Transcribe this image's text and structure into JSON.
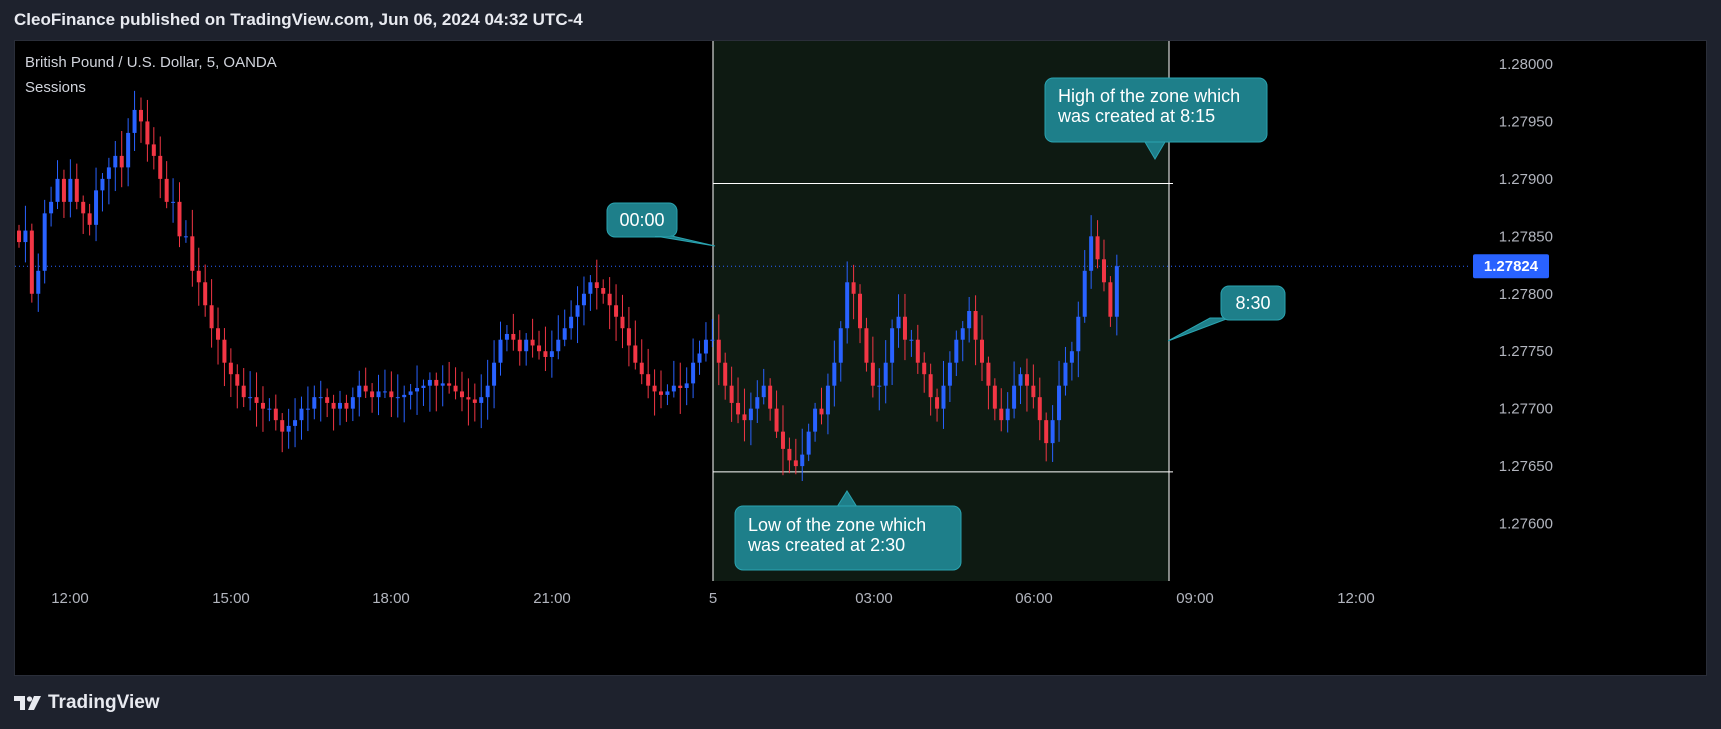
{
  "header": {
    "published": "CleoFinance published on TradingView.com, Jun 06, 2024 04:32 UTC-4"
  },
  "footer": {
    "brand": "TradingView",
    "logo_icon": "tradingview-logo-icon"
  },
  "colors": {
    "up": "#2962ff",
    "down": "#f23645",
    "zone_fill": "#0e1a12",
    "callout": "#1e7f8a",
    "price_tag": "#2962ff",
    "axis_text": "#b2b5be"
  },
  "chart_data": {
    "type": "candlestick",
    "symbol_line": "British Pound / U.S. Dollar, 5, OANDA",
    "indicator": "Sessions",
    "y_ticks": [
      "1.28000",
      "1.27950",
      "1.27900",
      "1.27850",
      "1.27800",
      "1.27750",
      "1.27700",
      "1.27650",
      "1.27600"
    ],
    "ylim": [
      1.2755,
      1.2802
    ],
    "x_ticks": [
      "12:00",
      "15:00",
      "18:00",
      "21:00",
      "5",
      "03:00",
      "06:00",
      "09:00",
      "12:00"
    ],
    "last_price": "1.27824",
    "session_zone": {
      "start": "00:00",
      "end": "08:30",
      "high": 1.27896,
      "low": 1.27645
    },
    "annotations": {
      "start_label": "00:00",
      "end_label": "8:30",
      "high_note": [
        "High of the zone which",
        "was created at 8:15"
      ],
      "low_note": [
        "Low of the zone which",
        "was created at 2:30"
      ]
    },
    "series": [
      {
        "name": "close",
        "values": [
          1.27845,
          1.27855,
          1.278,
          1.2782,
          1.2787,
          1.2788,
          1.279,
          1.2788,
          1.279,
          1.2788,
          1.2787,
          1.2786,
          1.2789,
          1.279,
          1.2791,
          1.2792,
          1.2791,
          1.2794,
          1.2796,
          1.2795,
          1.2793,
          1.2792,
          1.279,
          1.2788,
          1.2788,
          1.2785,
          1.2785,
          1.2782,
          1.2781,
          1.2779,
          1.2777,
          1.2776,
          1.2774,
          1.2773,
          1.2772,
          1.2771,
          1.2771,
          1.27705,
          1.277,
          1.277,
          1.2769,
          1.2768,
          1.27685,
          1.2769,
          1.277,
          1.277,
          1.2771,
          1.2771,
          1.27705,
          1.277,
          1.27705,
          1.277,
          1.2771,
          1.2772,
          1.27715,
          1.2771,
          1.27715,
          1.27715,
          1.2771,
          1.2771,
          1.27712,
          1.27715,
          1.27718,
          1.2772,
          1.27725,
          1.2772,
          1.27722,
          1.2772,
          1.27715,
          1.2771,
          1.27708,
          1.27705,
          1.2771,
          1.2772,
          1.2774,
          1.2776,
          1.27765,
          1.2776,
          1.2775,
          1.2776,
          1.27755,
          1.2775,
          1.27745,
          1.2775,
          1.2776,
          1.2777,
          1.2778,
          1.2779,
          1.278,
          1.2781,
          1.27805,
          1.278,
          1.2779,
          1.2778,
          1.2777,
          1.27755,
          1.2774,
          1.2773,
          1.2772,
          1.27715,
          1.27712,
          1.27715,
          1.2772,
          1.27718,
          1.27722,
          1.2774,
          1.27748,
          1.2776,
          1.2776,
          1.2774,
          1.2772,
          1.27705,
          1.27695,
          1.2769,
          1.277,
          1.2771,
          1.2772,
          1.277,
          1.2768,
          1.27665,
          1.27655,
          1.2765,
          1.2766,
          1.2768,
          1.277,
          1.27695,
          1.2772,
          1.2774,
          1.2777,
          1.2781,
          1.278,
          1.2777,
          1.2774,
          1.2772,
          1.2772,
          1.2774,
          1.2777,
          1.2778,
          1.2776,
          1.2776,
          1.2774,
          1.2773,
          1.2771,
          1.277,
          1.2772,
          1.2774,
          1.2776,
          1.2777,
          1.27785,
          1.2776,
          1.2774,
          1.2772,
          1.277,
          1.2769,
          1.277,
          1.2772,
          1.2773,
          1.2772,
          1.2771,
          1.2769,
          1.2767,
          1.2769,
          1.2772,
          1.2774,
          1.2775,
          1.2778,
          1.2782,
          1.2785,
          1.2783,
          1.2781,
          1.2778,
          1.27824
        ]
      }
    ]
  }
}
